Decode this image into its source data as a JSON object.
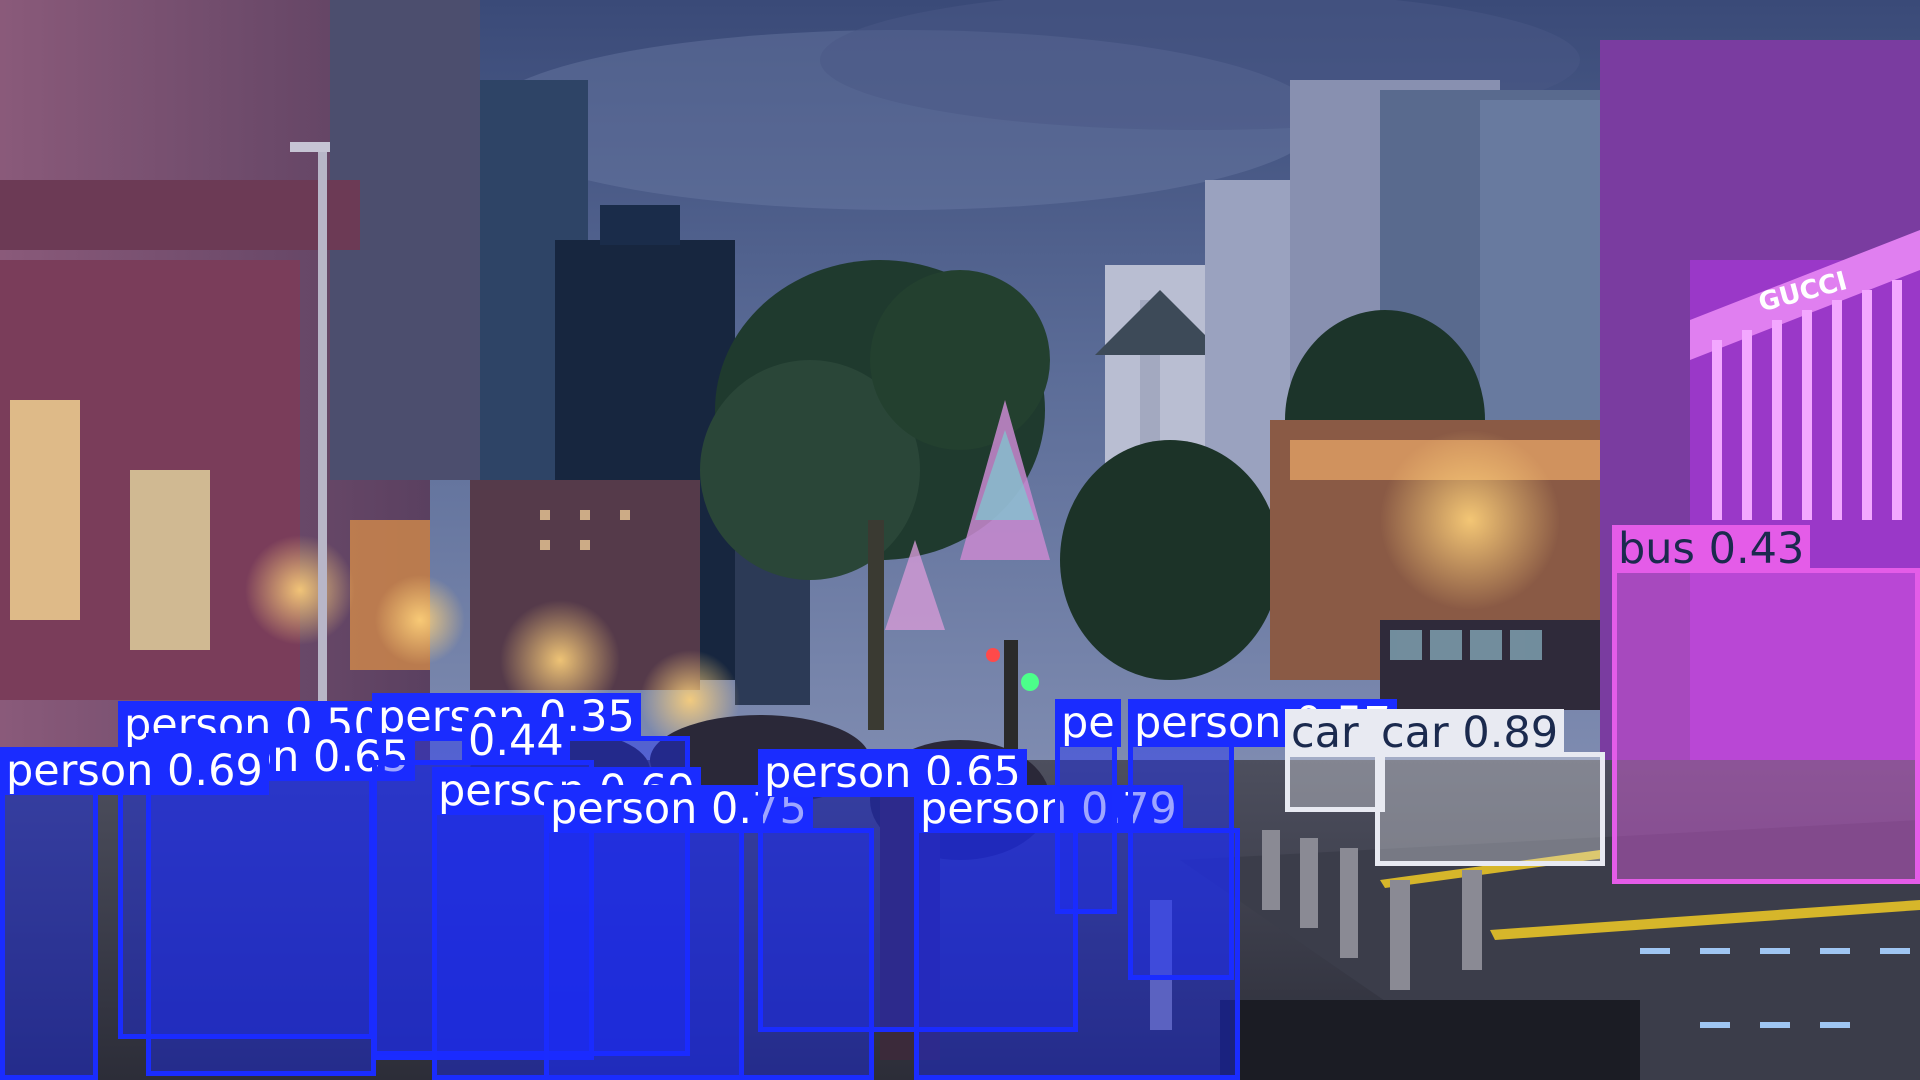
{
  "colors": {
    "person": "#1a2cff",
    "car": "#e8eaf2",
    "bus": "#e45ce8",
    "person_text": "#ffffff",
    "car_text": "#1b2a4e",
    "bus_text": "#1b2a4e"
  },
  "sign": {
    "brand": "GUCCI"
  },
  "detections": [
    {
      "label": "person 0.50",
      "class": "person"
    },
    {
      "label": "person 0.35",
      "class": "person"
    },
    {
      "label": "person 0.65",
      "class": "person"
    },
    {
      "label": "0.44",
      "class": "person"
    },
    {
      "label": "person 0.69",
      "class": "person"
    },
    {
      "label": "person 0.69",
      "class": "person"
    },
    {
      "label": "person 0.75",
      "class": "person"
    },
    {
      "label": "person 0.65",
      "class": "person"
    },
    {
      "label": "person 0.79",
      "class": "person"
    },
    {
      "label": "pe",
      "class": "person"
    },
    {
      "label": "person 0.57",
      "class": "person"
    },
    {
      "label": "car 0.75",
      "class": "car"
    },
    {
      "label": "car 0.89",
      "class": "car"
    },
    {
      "label": "bus 0.43",
      "class": "bus"
    }
  ]
}
